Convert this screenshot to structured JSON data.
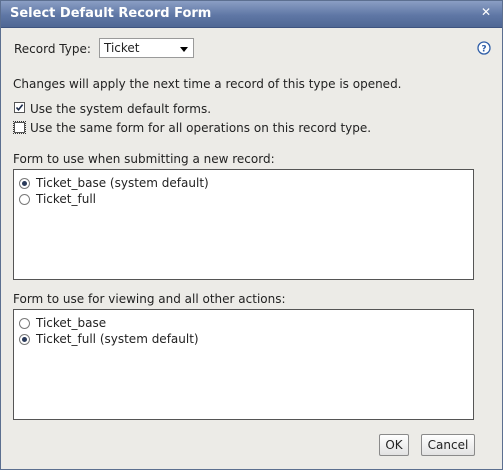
{
  "dialog": {
    "title": "Select Default Record Form",
    "close_glyph": "✕"
  },
  "record_type": {
    "label": "Record Type:",
    "value": "Ticket"
  },
  "help_glyph": "?",
  "info_text": "Changes will apply the next time a record of this type is opened.",
  "options": {
    "system_default": {
      "label": "Use the system default forms.",
      "checked": true
    },
    "same_form": {
      "label": "Use the same form for all operations on this record type.",
      "checked": false
    }
  },
  "submit_section": {
    "label": "Form to use when submitting a new record:",
    "items": [
      {
        "label": "Ticket_base (system default)",
        "selected": true
      },
      {
        "label": "Ticket_full",
        "selected": false
      }
    ]
  },
  "view_section": {
    "label": "Form to use for viewing and all other actions:",
    "items": [
      {
        "label": "Ticket_base",
        "selected": false
      },
      {
        "label": "Ticket_full (system default)",
        "selected": true
      }
    ]
  },
  "buttons": {
    "ok": "OK",
    "cancel": "Cancel"
  },
  "colors": {
    "title_bar": "#5f77a5",
    "dialog_bg": "#ecebe7",
    "help_icon": "#2f5ea8"
  }
}
